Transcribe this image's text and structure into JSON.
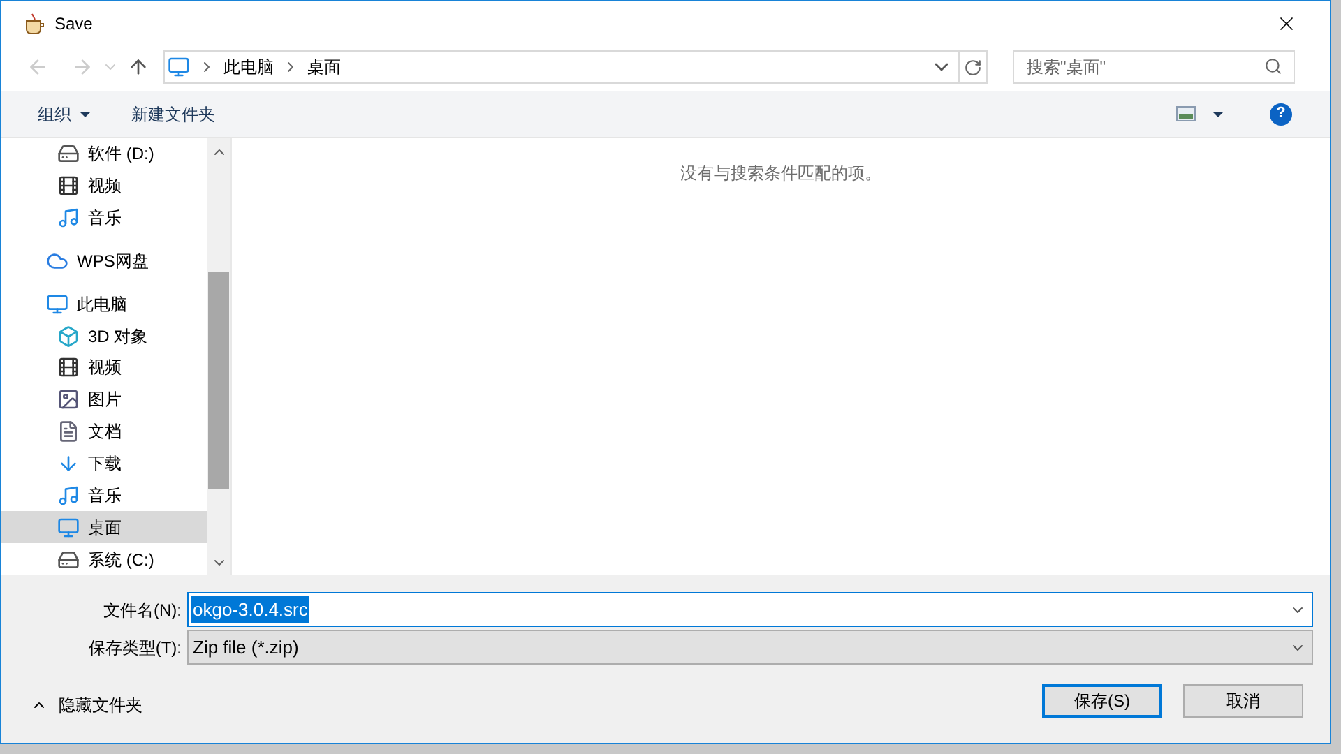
{
  "window": {
    "title": "Save"
  },
  "address": {
    "crumbs": [
      "此电脑",
      "桌面"
    ]
  },
  "search": {
    "placeholder": "搜索\"桌面\""
  },
  "toolbar": {
    "organize": "组织",
    "new_folder": "新建文件夹",
    "help": "?"
  },
  "sidebar": {
    "items": [
      {
        "label": "软件 (D:)",
        "kind": "drive",
        "selected": false
      },
      {
        "label": "视频",
        "kind": "video",
        "selected": false
      },
      {
        "label": "音乐",
        "kind": "music",
        "selected": false
      },
      {
        "label": "WPS网盘",
        "kind": "cloud",
        "selected": false
      },
      {
        "label": "此电脑",
        "kind": "pc",
        "selected": false,
        "children": [
          {
            "label": "3D 对象",
            "kind": "cube",
            "selected": false
          },
          {
            "label": "视频",
            "kind": "video",
            "selected": false
          },
          {
            "label": "图片",
            "kind": "picture",
            "selected": false
          },
          {
            "label": "文档",
            "kind": "doc",
            "selected": false
          },
          {
            "label": "下载",
            "kind": "download",
            "selected": false
          },
          {
            "label": "音乐",
            "kind": "music",
            "selected": false
          },
          {
            "label": "桌面",
            "kind": "desktop",
            "selected": true
          },
          {
            "label": "系统 (C:)",
            "kind": "drive",
            "selected": false
          }
        ]
      }
    ]
  },
  "content": {
    "empty_message": "没有与搜索条件匹配的项。"
  },
  "form": {
    "filename_label": "文件名(N):",
    "filename": "okgo-3.0.4.src",
    "type_label": "保存类型(T):",
    "type": "Zip file (*.zip)"
  },
  "footer": {
    "hide_folders": "隐藏文件夹",
    "save": "保存(S)",
    "cancel": "取消"
  }
}
